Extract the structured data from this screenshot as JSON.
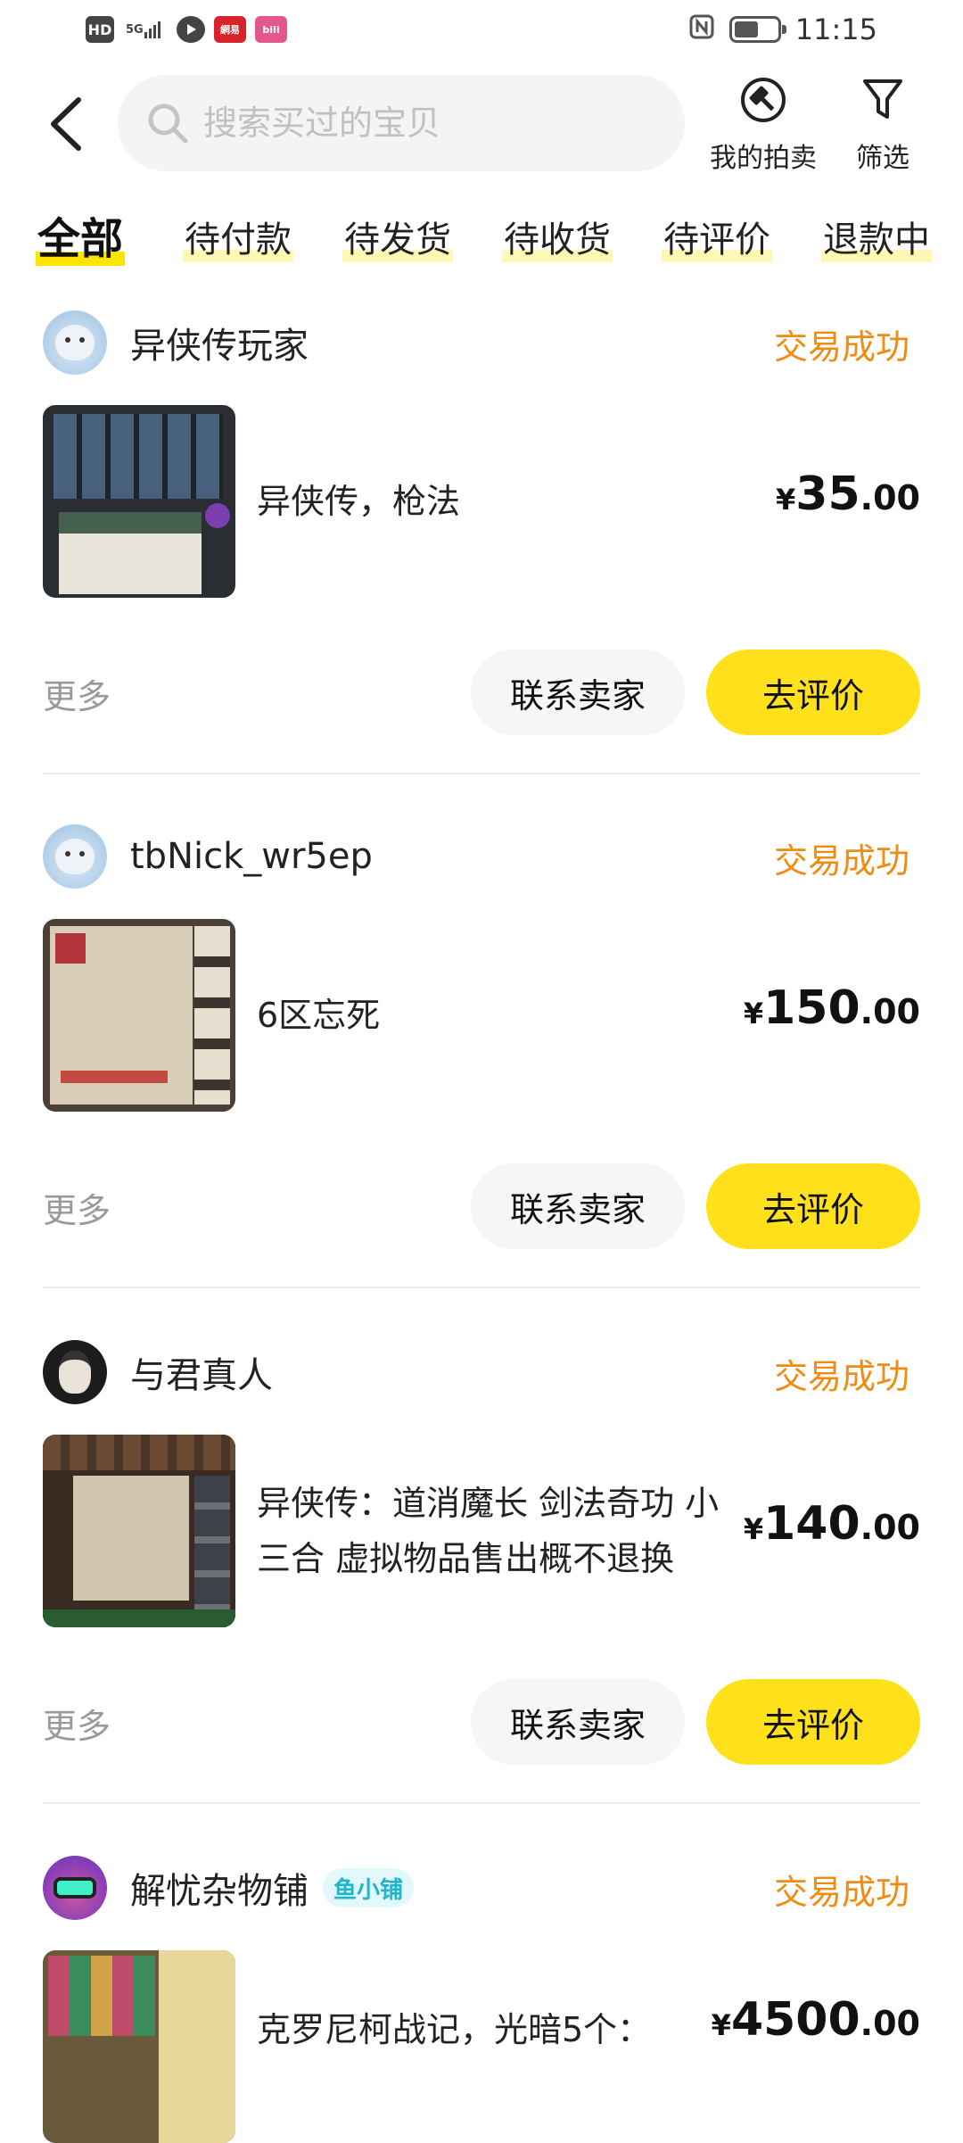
{
  "status_bar": {
    "hd": "HD",
    "signal": "5G",
    "netease": "網易",
    "bilibili": "bili",
    "time": "11:15"
  },
  "header": {
    "search_placeholder": "搜索买过的宝贝",
    "auction_label": "我的拍卖",
    "filter_label": "筛选"
  },
  "tabs": [
    {
      "label": "全部",
      "active": true
    },
    {
      "label": "待付款",
      "active": false
    },
    {
      "label": "待发货",
      "active": false
    },
    {
      "label": "待收货",
      "active": false
    },
    {
      "label": "待评价",
      "active": false
    },
    {
      "label": "退款中",
      "active": false
    }
  ],
  "orders": [
    {
      "seller": "异侠传玩家",
      "status": "交易成功",
      "title": "异侠传，枪法",
      "price_currency": "¥",
      "price_int": "35",
      "price_dec": ".00",
      "more": "更多",
      "contact": "联系卖家",
      "review": "去评价"
    },
    {
      "seller": "tbNick_wr5ep",
      "status": "交易成功",
      "title": "6区忘死",
      "price_currency": "¥",
      "price_int": "150",
      "price_dec": ".00",
      "more": "更多",
      "contact": "联系卖家",
      "review": "去评价"
    },
    {
      "seller": "与君真人",
      "status": "交易成功",
      "title": "异侠传：道消魔长 剑法奇功 小三合 虚拟物品售出概不退换",
      "price_currency": "¥",
      "price_int": "140",
      "price_dec": ".00",
      "more": "更多",
      "contact": "联系卖家",
      "review": "去评价"
    },
    {
      "seller": "解忧杂物铺",
      "badge": "鱼小铺",
      "status": "交易成功",
      "title": "克罗尼柯战记，光暗5个：",
      "price_currency": "¥",
      "price_int": "4500",
      "price_dec": ".00"
    }
  ],
  "colors": {
    "accent_yellow": "#ffe11b",
    "status_orange": "#f08c12",
    "badge_teal": "#1fb6cd"
  }
}
